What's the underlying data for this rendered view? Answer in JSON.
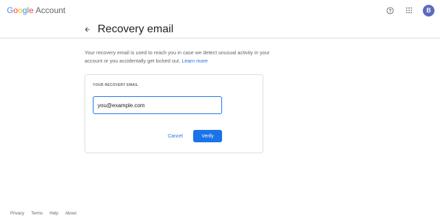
{
  "header": {
    "logo_letters": [
      {
        "char": "G",
        "color": "#4285f4"
      },
      {
        "char": "o",
        "color": "#ea4335"
      },
      {
        "char": "o",
        "color": "#fbbc05"
      },
      {
        "char": "g",
        "color": "#4285f4"
      },
      {
        "char": "l",
        "color": "#34a853"
      },
      {
        "char": "e",
        "color": "#ea4335"
      }
    ],
    "logo_suffix": "Account",
    "help_icon": "help-circle-icon",
    "apps_icon": "apps-grid-icon",
    "avatar_initial": "B",
    "avatar_color": "#5c6bc0"
  },
  "page": {
    "title": "Recovery email",
    "back_icon": "arrow-back-icon",
    "description": "Your recovery email is used to reach you in case we detect unusual activity in your account or you accidentally get locked out.",
    "learn_more": "Learn more"
  },
  "card": {
    "label": "YOUR RECOVERY EMAIL",
    "email_value": "you@example.com",
    "cancel_label": "Cancel",
    "verify_label": "Verify"
  },
  "footer": {
    "links": [
      "Privacy",
      "Terms",
      "Help",
      "About"
    ]
  },
  "colors": {
    "accent": "#1a73e8",
    "text_secondary": "#5f6368",
    "border": "#dadce0"
  }
}
